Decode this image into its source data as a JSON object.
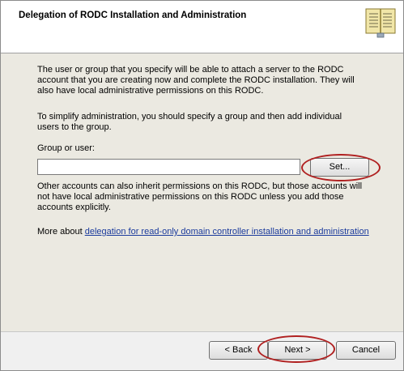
{
  "dialog": {
    "title": "Delegation of RODC Installation and Administration"
  },
  "content": {
    "paragraph1": "The user or group that you specify will be able to attach a server to the RODC account that you are creating now and complete the RODC installation. They will also have local administrative permissions on this RODC.",
    "paragraph2": "To simplify administration, you should specify a group and then add individual users to the group.",
    "group_label": "Group or user:",
    "group_value": "",
    "set_button": "Set...",
    "paragraph3": "Other accounts can also inherit permissions on this RODC, but those accounts will not have local administrative permissions on this RODC unless you add those accounts explicitly.",
    "more_prefix": "More about ",
    "more_link": "delegation for read-only domain controller installation and administration"
  },
  "footer": {
    "back_label": "< Back",
    "next_label": "Next >",
    "cancel_label": "Cancel"
  },
  "colors": {
    "link": "#1a3a9c",
    "highlight": "#b02020",
    "content_bg": "#ebe9e1"
  },
  "icons": {
    "header": "book-icon"
  }
}
